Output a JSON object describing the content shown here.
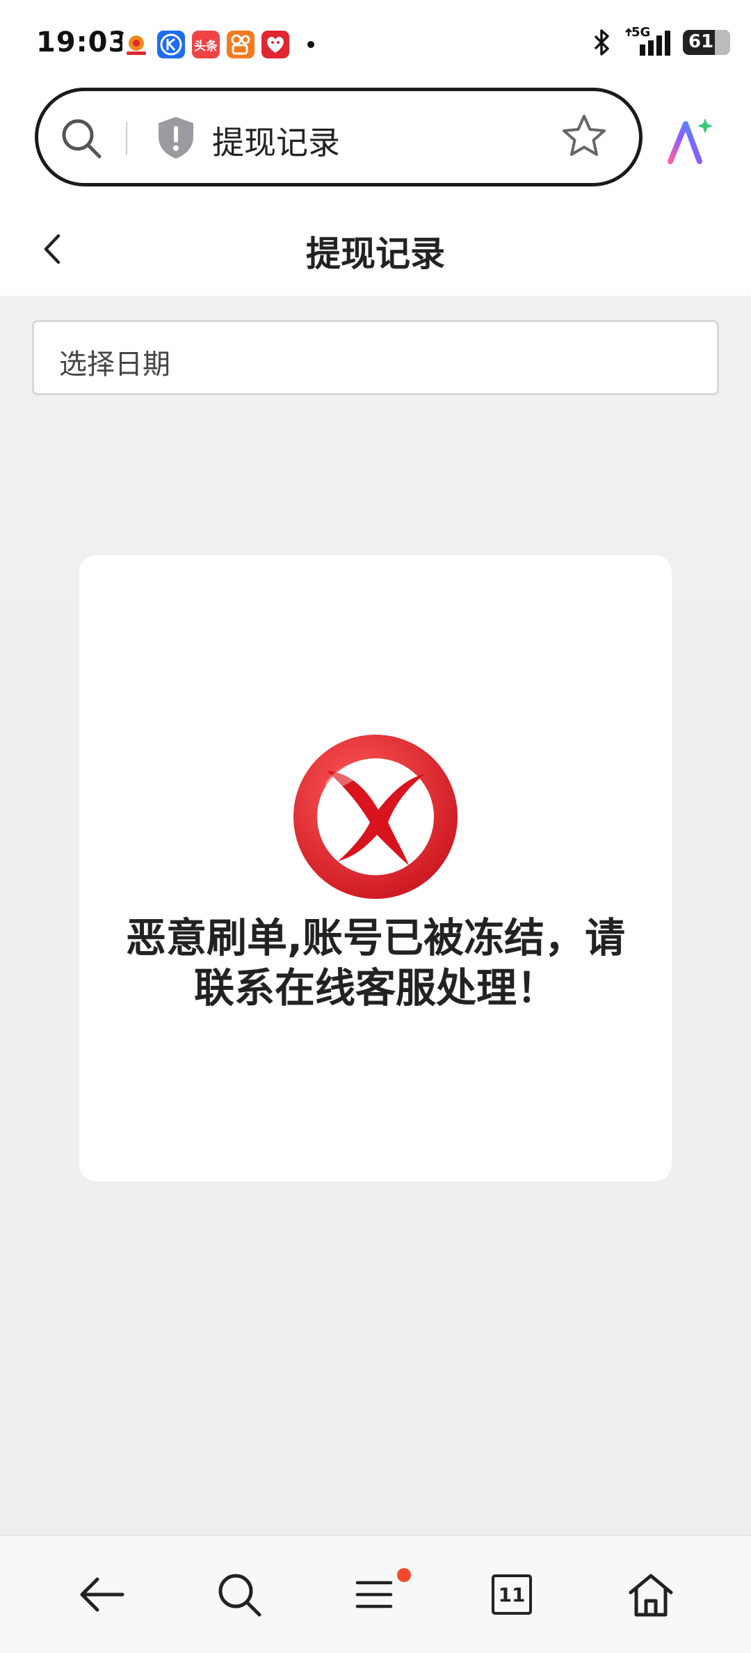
{
  "status_bar": {
    "time": "19:03",
    "network": "5G",
    "battery": "61",
    "notifications": [
      {
        "name": "app-icon-1",
        "label": "",
        "color": "#f5f5f5"
      },
      {
        "name": "app-icon-k",
        "label": "K",
        "color": "#1e6cf0"
      },
      {
        "name": "app-icon-toutiao",
        "label": "头条",
        "color": "#f04444"
      },
      {
        "name": "app-icon-kuaishou",
        "label": "",
        "color": "#f57a1f"
      },
      {
        "name": "app-icon-pinduoduo",
        "label": "",
        "color": "#e0262f"
      }
    ]
  },
  "browser": {
    "address_text": "提现记录"
  },
  "header": {
    "title": "提现记录"
  },
  "date_picker": {
    "placeholder": "选择日期"
  },
  "modal": {
    "message": "恶意刷单,账号已被冻结，请联系在线客服处理！"
  },
  "bottom_nav": {
    "tabs_count": "11"
  },
  "colors": {
    "accent_red": "#e0262f",
    "menu_badge": "#f04a2a"
  }
}
